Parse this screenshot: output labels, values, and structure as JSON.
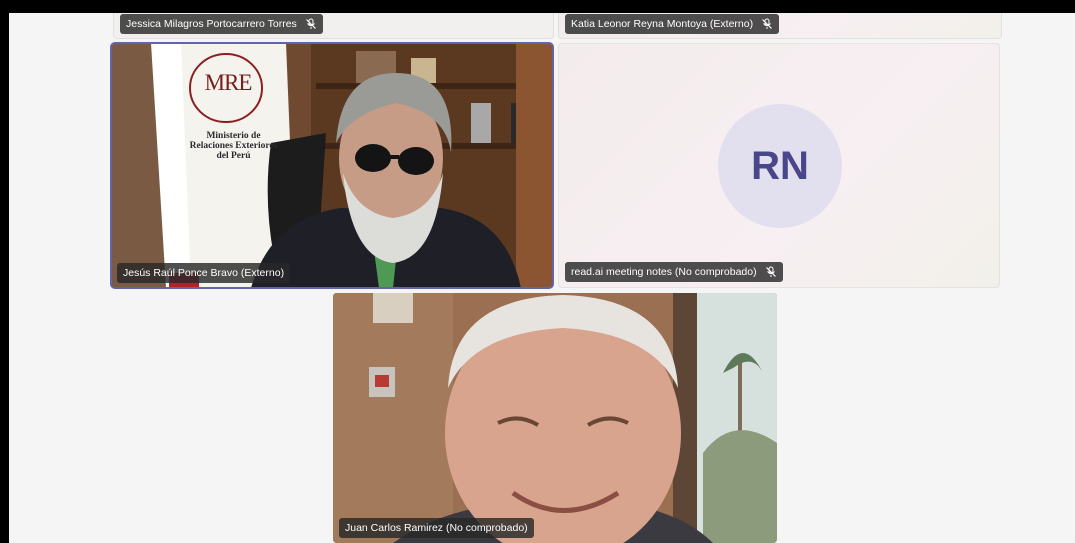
{
  "participants": [
    {
      "name": "Jessica Milagros Portocarrero Torres",
      "muted": true
    },
    {
      "name": "Katia Leonor Reyna Montoya (Externo)",
      "muted": true
    },
    {
      "name": "Jesús Raúl Ponce Bravo (Externo)",
      "muted": false,
      "active_speaker": true
    },
    {
      "name": "read.ai meeting notes (No comprobado)",
      "muted": true,
      "initials": "RN"
    },
    {
      "name": "Juan Carlos Ramirez (No comprobado)",
      "muted": false
    }
  ],
  "flag_text": {
    "logo": "MRE",
    "line1": "Ministerio de",
    "line2": "Relaciones Exteriores",
    "line3": "del Perú"
  },
  "colors": {
    "active_border": "#6264a7",
    "avatar_bg": "#e2e0ee",
    "avatar_text": "#49478a"
  }
}
